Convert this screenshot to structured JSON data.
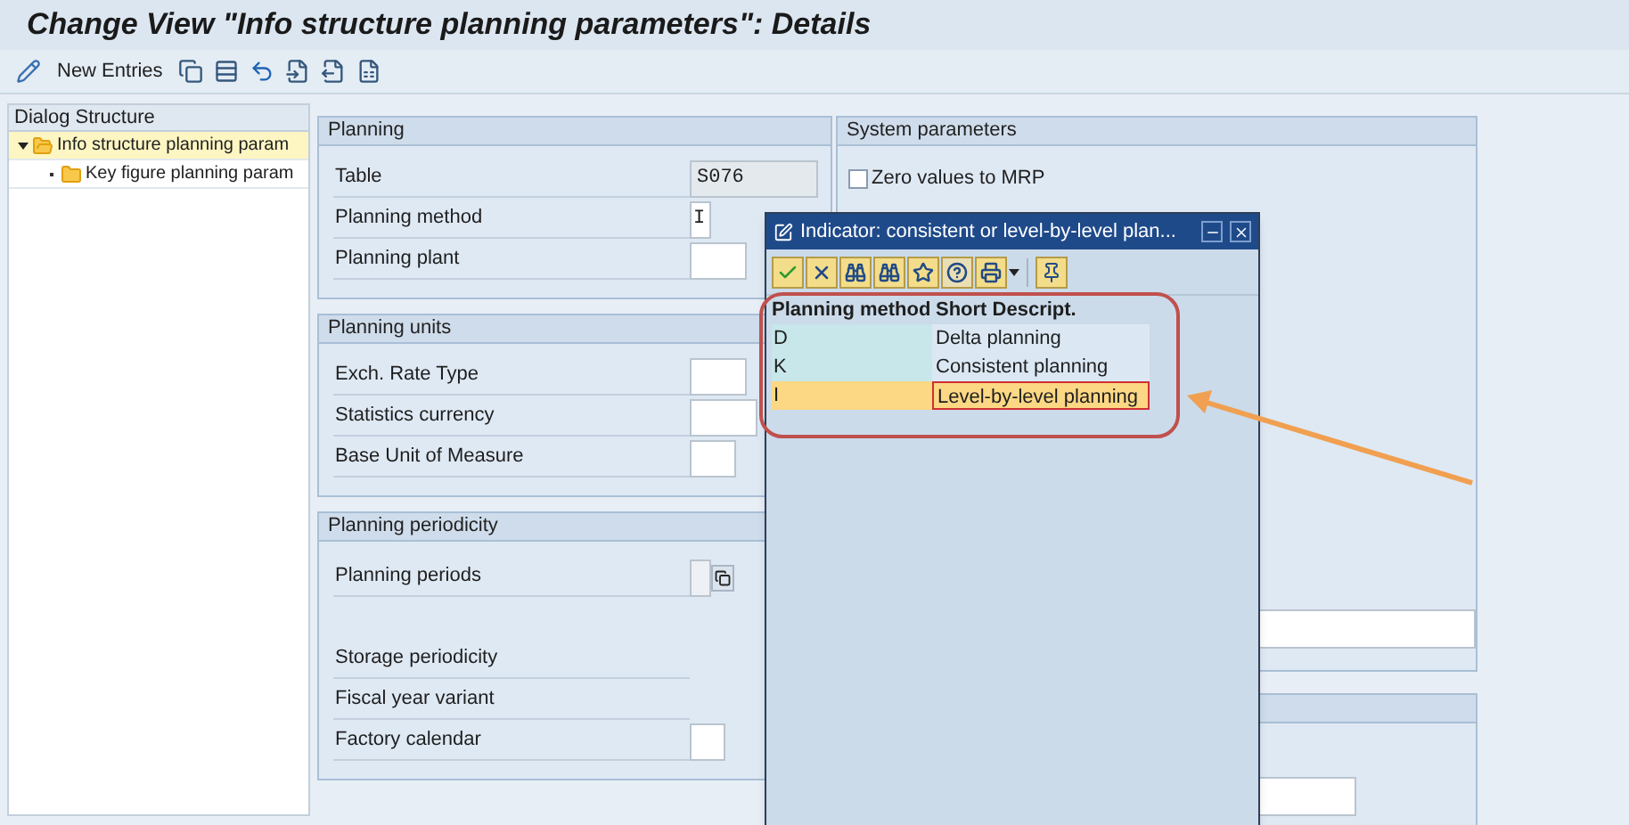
{
  "window": {
    "title": "Change View \"Info structure planning parameters\": Details"
  },
  "toolbar": {
    "new_entries": "New Entries"
  },
  "dialog_structure": {
    "title": "Dialog Structure",
    "items": [
      {
        "label": "Info structure planning param",
        "selected": true,
        "expanded": true,
        "children": [
          {
            "label": "Key figure planning param",
            "selected": false
          }
        ]
      }
    ]
  },
  "sections": [
    {
      "title": "Planning",
      "fields": [
        {
          "label": "Table",
          "value": "S076",
          "kind": "display"
        },
        {
          "label": "Planning method",
          "value": "I",
          "kind": "input"
        },
        {
          "label": "Planning plant",
          "kind": "input"
        }
      ]
    },
    {
      "title": "Planning units",
      "fields": [
        {
          "label": "Exch. Rate Type",
          "kind": "input"
        },
        {
          "label": "Statistics currency",
          "kind": "input"
        },
        {
          "label": "Base Unit of Measure",
          "kind": "input"
        }
      ]
    },
    {
      "title": "Planning periodicity",
      "fields": [
        {
          "label": "Planning periods",
          "kind": "input_f4"
        },
        {
          "label": "Storage periodicity",
          "kind": "none"
        },
        {
          "label": "Fiscal year variant",
          "kind": "none"
        },
        {
          "label": "Factory calendar",
          "kind": "input"
        }
      ]
    }
  ],
  "system_parameters": {
    "title": "System parameters",
    "checkboxes": [
      {
        "label": "Zero values to MRP",
        "checked": false
      }
    ]
  },
  "popup": {
    "title": "Indicator: consistent or level-by-level plan...",
    "columns": [
      "Planning method",
      "Short Descript."
    ],
    "rows": [
      {
        "cells": [
          "D",
          "Delta planning"
        ],
        "selected": false
      },
      {
        "cells": [
          "K",
          "Consistent planning"
        ],
        "selected": false
      },
      {
        "cells": [
          "I",
          "Level-by-level planning"
        ],
        "selected": true
      }
    ]
  }
}
